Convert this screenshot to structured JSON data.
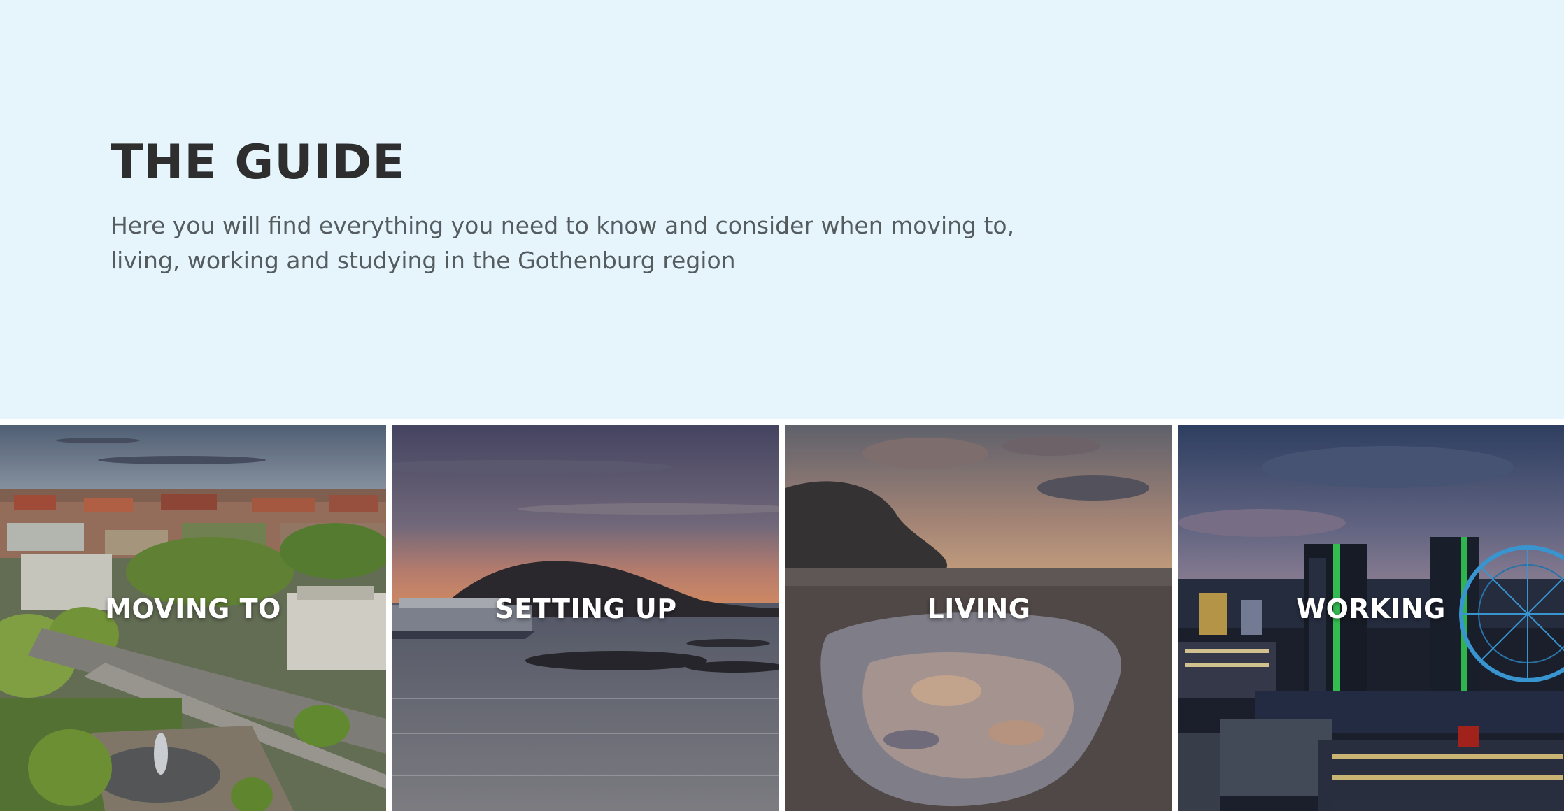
{
  "hero": {
    "title": "THE GUIDE",
    "description": "Here you will find everything you need to know and consider when moving to, living, working and studying in the Gothenburg region"
  },
  "tiles": [
    {
      "label": "MOVING TO",
      "image": "gothenburg-city-aerial"
    },
    {
      "label": "SETTING UP",
      "image": "archipelago-sunset-ferry"
    },
    {
      "label": "LIVING",
      "image": "rock-pool-reflection"
    },
    {
      "label": "WORKING",
      "image": "city-night-ferris-wheel"
    }
  ],
  "colors": {
    "hero_background": "#e6f5fc",
    "title": "#2e2e2e",
    "description": "#555c60",
    "tile_label": "#ffffff"
  }
}
